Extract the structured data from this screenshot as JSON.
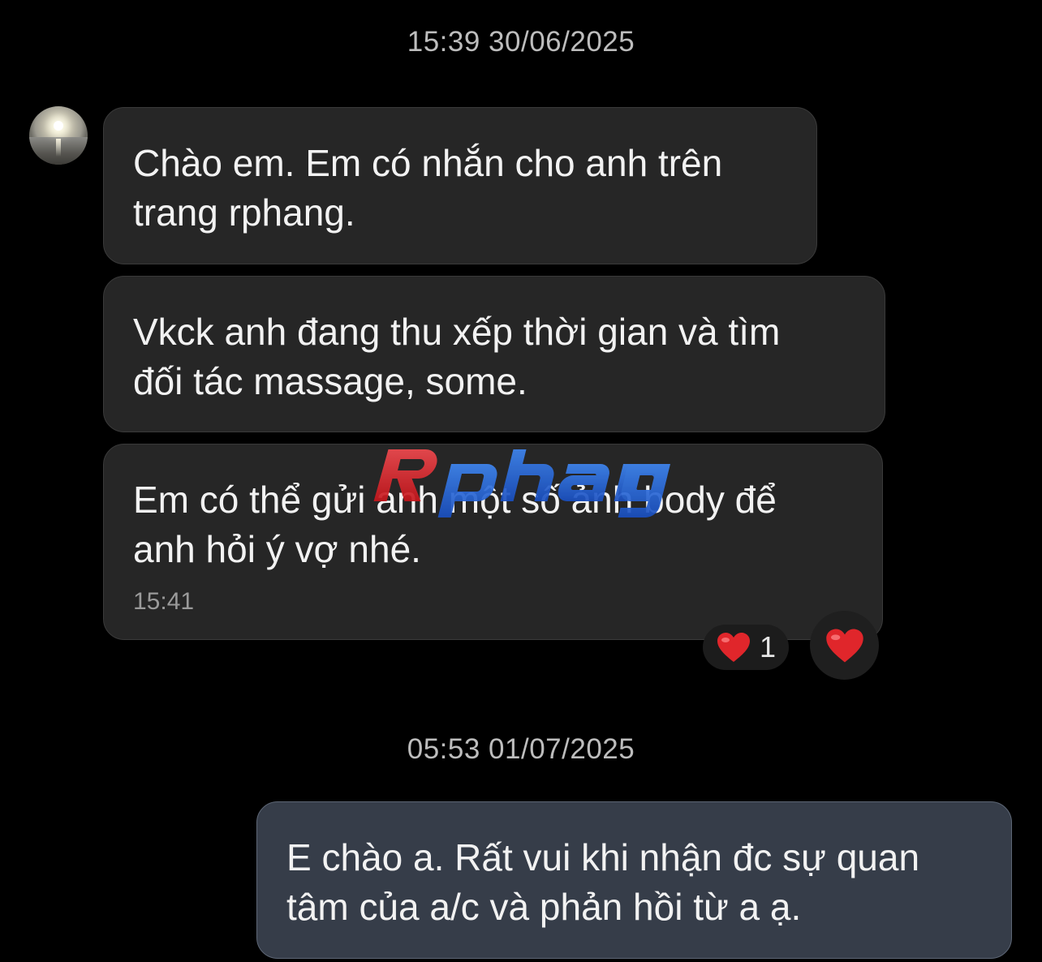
{
  "conversation": {
    "date_separators": [
      {
        "text": "15:39 30/06/2025"
      },
      {
        "text": "05:53 01/07/2025"
      }
    ],
    "incoming_messages": [
      {
        "text": "Chào em. Em có nhắn cho anh trên\ntrang rphang."
      },
      {
        "text": "Vkck anh đang thu xếp thời gian và tìm\nđối tác massage, some."
      },
      {
        "text": "Em có thể gửi anh một số ảnh body để\nanh hỏi ý vợ nhé.",
        "time": "15:41"
      }
    ],
    "reactions": {
      "emoji": "heart",
      "count": "1",
      "color": "#e0262b"
    },
    "outgoing_messages": [
      {
        "text": "E chào a. Rất vui khi nhận đc sự quan\ntâm của a/c và phản hồi từ a ạ."
      }
    ]
  },
  "watermark": {
    "text": "Rphang",
    "colors": {
      "red": "#e3262c",
      "blue": "#1f5fd6"
    }
  },
  "theme": {
    "background": "#000000",
    "incoming_bubble": "#262626",
    "outgoing_bubble": "#363d49",
    "text": "#f2f2f2",
    "muted_text": "#bdbdbd"
  }
}
